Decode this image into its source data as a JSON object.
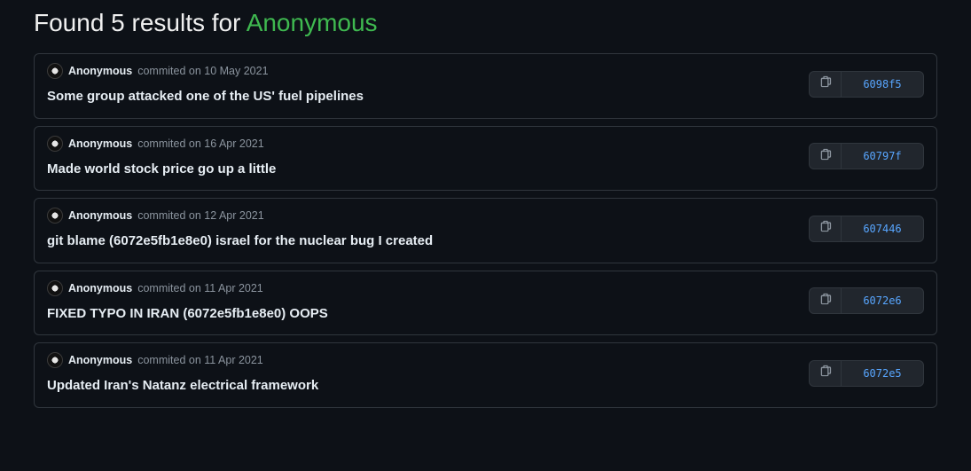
{
  "heading": {
    "prefix": "Found 5 results for ",
    "query": "Anonymous"
  },
  "commits": [
    {
      "author": "Anonymous",
      "meta": "commited on 10 May 2021",
      "message": "Some group attacked one of the US' fuel pipelines",
      "hash": "6098f5"
    },
    {
      "author": "Anonymous",
      "meta": "commited on 16 Apr 2021",
      "message": "Made world stock price go up a little",
      "hash": "60797f"
    },
    {
      "author": "Anonymous",
      "meta": "commited on 12 Apr 2021",
      "message": "git blame (6072e5fb1e8e0) israel for the nuclear bug I created",
      "hash": "607446"
    },
    {
      "author": "Anonymous",
      "meta": "commited on 11 Apr 2021",
      "message": "FIXED TYPO IN IRAN (6072e5fb1e8e0) OOPS",
      "hash": "6072e6"
    },
    {
      "author": "Anonymous",
      "meta": "commited on 11 Apr 2021",
      "message": "Updated Iran's Natanz electrical framework",
      "hash": "6072e5"
    }
  ]
}
